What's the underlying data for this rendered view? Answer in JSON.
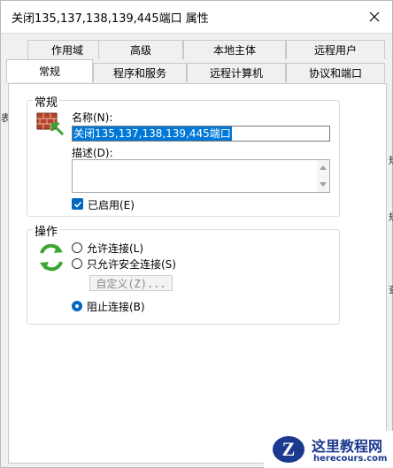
{
  "dialog": {
    "title": "关闭135,137,138,139,445端口 属性"
  },
  "tabs": {
    "row_top": [
      "作用域",
      "高级",
      "本地主体",
      "远程用户"
    ],
    "row_bottom": [
      "常规",
      "程序和服务",
      "远程计算机",
      "协议和端口"
    ],
    "active": "常规"
  },
  "general_group": {
    "label": "常规",
    "name_label": "名称(N):",
    "name_value": "关闭135,137,138,139,445端口",
    "description_label": "描述(D):",
    "description_value": "",
    "enabled_label": "已启用(E)",
    "enabled": true
  },
  "action_group": {
    "label": "操作",
    "options": [
      "允许连接(L)",
      "只允许安全连接(S)",
      "阻止连接(B)"
    ],
    "selected": "阻止连接(B)",
    "custom_button": "自定义(Z)..."
  },
  "background": {
    "left_glyphs": [
      "表"
    ],
    "right_glyphs": [
      "规",
      "规",
      "查"
    ]
  },
  "watermark": {
    "title": "这里教程网",
    "url": "herecours.com",
    "logo_letter": "Z"
  },
  "colors": {
    "accent": "#0067c0",
    "selection": "#0078d7",
    "firewall_brick": "#b5422a",
    "arrow_green": "#3aa62f"
  }
}
